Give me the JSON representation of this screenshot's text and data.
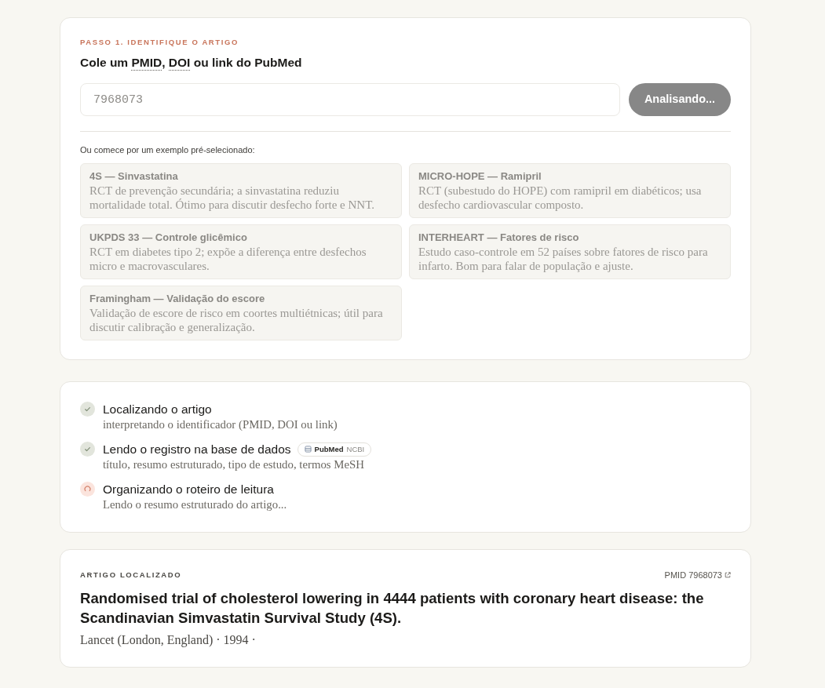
{
  "step1": {
    "label": "PASSO 1. IDENTIFIQUE O ARTIGO",
    "heading": [
      {
        "text": "Cole um ",
        "abbr": false
      },
      {
        "text": "PMID",
        "abbr": true
      },
      {
        "text": ", ",
        "abbr": false
      },
      {
        "text": "DOI",
        "abbr": true
      },
      {
        "text": " ou link do PubMed",
        "abbr": false
      }
    ],
    "input": {
      "value": "7968073",
      "disabled": true
    },
    "submit_button": {
      "label": "Analisando...",
      "disabled": true
    },
    "examples_label": "Ou comece por um exemplo pré-selecionado:",
    "examples": [
      {
        "title": "4S — Sinvastatina",
        "description": "RCT de prevenção secundária; a sinvastatina reduziu mortalidade total. Ótimo para discutir desfecho forte e NNT.",
        "disabled": true
      },
      {
        "title": "MICRO-HOPE — Ramipril",
        "description": "RCT (subestudo do HOPE) com ramipril em diabéticos; usa desfecho cardiovascular composto.",
        "disabled": true
      },
      {
        "title": "UKPDS 33 — Controle glicêmico",
        "description": "RCT em diabetes tipo 2; expõe a diferença entre desfechos micro e macrovasculares.",
        "disabled": true
      },
      {
        "title": "INTERHEART — Fatores de risco",
        "description": "Estudo caso-controle em 52 países sobre fatores de risco para infarto. Bom para falar de população e ajuste.",
        "disabled": true
      },
      {
        "title": "Framingham — Validação do escore",
        "description": "Validação de escore de risco em coortes multiétnicas; útil para discutir calibração e generalização.",
        "disabled": true
      }
    ]
  },
  "progress": {
    "steps": [
      {
        "title": "Localizando o artigo",
        "detail": "interpretando o identificador (PMID, DOI ou link)",
        "done": true
      },
      {
        "title": "Lendo o registro na base de dados",
        "badge": {
          "name": "PubMed",
          "source": "NCBI"
        },
        "detail": "título, resumo estruturado, tipo de estudo, termos MeSH",
        "done": true
      },
      {
        "title": "Organizando o roteiro de leitura",
        "detail": "Lendo o resumo estruturado do artigo...",
        "done": false
      }
    ]
  },
  "article": {
    "label": "ARTIGO LOCALIZADO",
    "pmid_link": "PMID 7968073",
    "title": "Randomised trial of cholesterol lowering in 4444 patients with coronary heart disease: the Scandinavian Simvastatin Survival Study (4S).",
    "meta": "Lancet (London, England) · 1994 ·"
  }
}
